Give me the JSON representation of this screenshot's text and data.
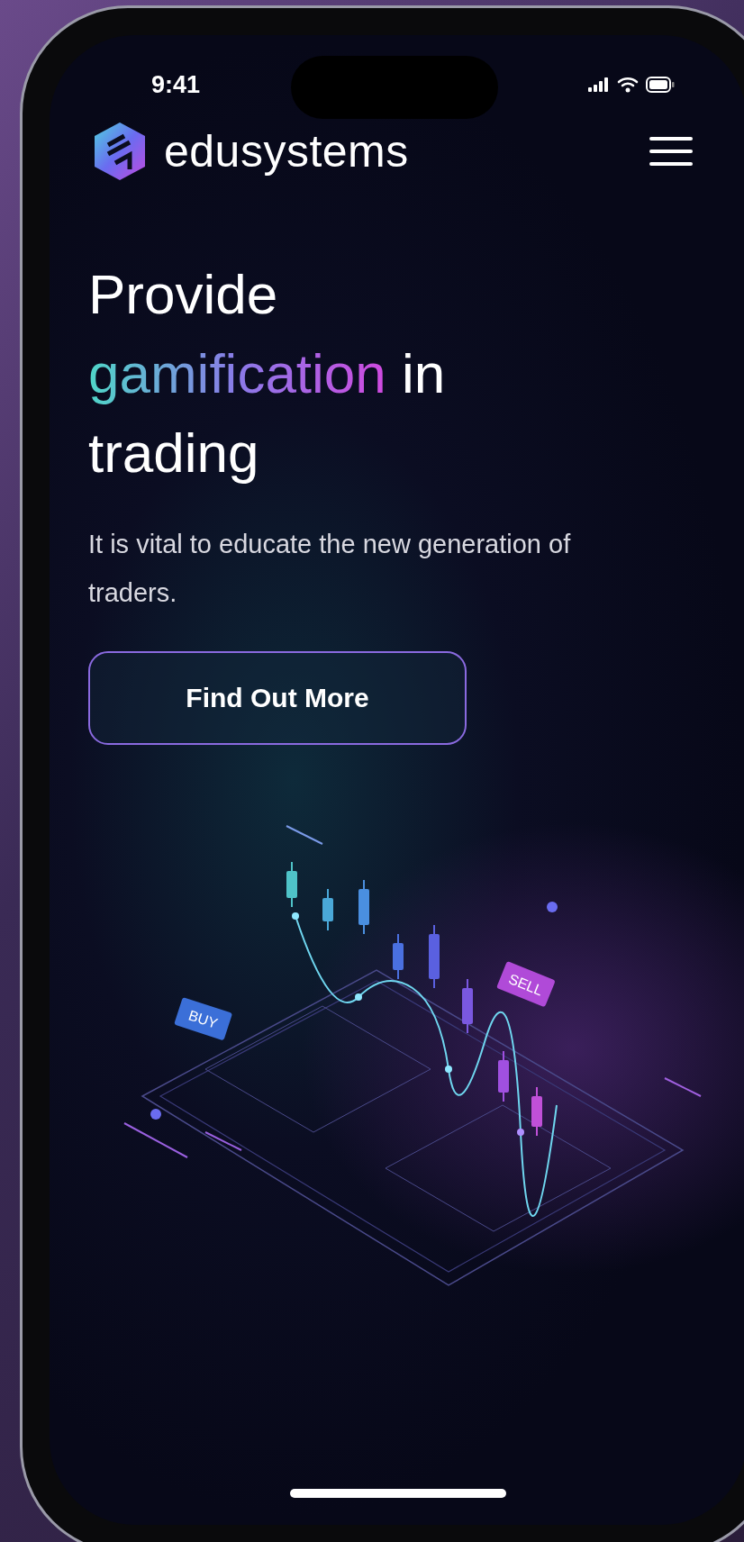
{
  "status_bar": {
    "time": "9:41"
  },
  "header": {
    "brand": "edusystems"
  },
  "hero": {
    "heading_parts": [
      {
        "text": "Provide",
        "kind": "plain"
      },
      {
        "text": "gamification",
        "kind": "gradient"
      },
      {
        "text": "in trading",
        "kind": "plain"
      }
    ],
    "subtitle": "It is vital to educate the new generation of traders.",
    "button": "Find Out More"
  },
  "illustration": {
    "tags": [
      {
        "text": "BUY",
        "kind": "buy"
      },
      {
        "text": "SELL",
        "kind": "sell"
      }
    ]
  }
}
